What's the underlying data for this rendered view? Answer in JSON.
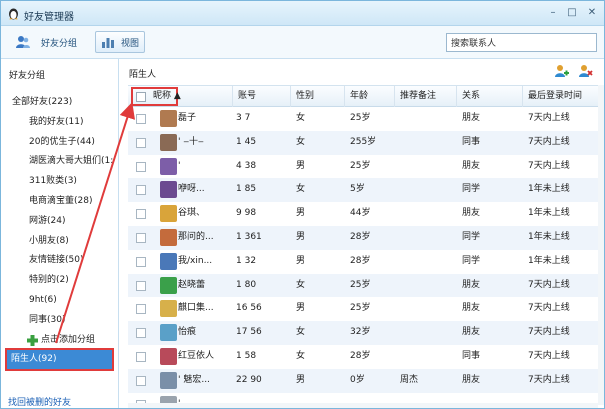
{
  "window": {
    "title": "好友管理器",
    "minimize": "–",
    "maximize": "□",
    "close": "✕"
  },
  "toolbar": {
    "friends_label": "好友分组",
    "view_label": "视图",
    "search_value": "搜索联系人"
  },
  "sidebar": {
    "header": "好友分组",
    "groups": [
      {
        "label": "全部好友(223)",
        "kind": "all"
      },
      {
        "label": "我的好友(11)"
      },
      {
        "label": "20的优生子(44)"
      },
      {
        "label": "湖医滴大哥大姐们(1:"
      },
      {
        "label": "311败类(3)"
      },
      {
        "label": "电商滴宝董(28)"
      },
      {
        "label": "网游(24)"
      },
      {
        "label": "小朋友(8)"
      },
      {
        "label": "友情链接(50)"
      },
      {
        "label": "特别的(2)"
      },
      {
        "label": "9ht(6)"
      },
      {
        "label": "同事(30)"
      },
      {
        "label": "点击添加分组",
        "kind": "add"
      },
      {
        "label": "陌生人(92)",
        "kind": "sel"
      }
    ],
    "find_link": "找回被删的好友"
  },
  "main": {
    "title": "陌生人",
    "columns": [
      "昵称 ▲",
      "账号",
      "性别",
      "年龄",
      "推荐备注",
      "关系",
      "最后登录时间"
    ],
    "rows": [
      {
        "nick": "磊子",
        "acct": "3     7",
        "gender": "女",
        "age": "25岁",
        "note": "",
        "rel": "朋友",
        "last": "7天内上线",
        "color": "#b07a50"
      },
      {
        "nick": "'    ‒十‒",
        "acct": "1     45",
        "gender": "女",
        "age": "255岁",
        "note": "",
        "rel": "同事",
        "last": "7天内上线",
        "color": "#8a6a55"
      },
      {
        "nick": "'",
        "acct": "4     38",
        "gender": "男",
        "age": "25岁",
        "note": "",
        "rel": "朋友",
        "last": "7天内上线",
        "color": "#7d5ea8"
      },
      {
        "nick": "咿呀...",
        "acct": "1     85",
        "gender": "女",
        "age": "5岁",
        "note": "",
        "rel": "同学",
        "last": "1年未上线",
        "color": "#6b4a90"
      },
      {
        "nick": "谷琪、",
        "acct": "9     98",
        "gender": "男",
        "age": "44岁",
        "note": "",
        "rel": "朋友",
        "last": "1年未上线",
        "color": "#d9a43a"
      },
      {
        "nick": "那问的...",
        "acct": "1     361",
        "gender": "男",
        "age": "28岁",
        "note": "",
        "rel": "同学",
        "last": "1年未上线",
        "color": "#c46b3c"
      },
      {
        "nick": "我/xin...",
        "acct": "1     32",
        "gender": "男",
        "age": "28岁",
        "note": "",
        "rel": "同学",
        "last": "1年未上线",
        "color": "#4a78b8"
      },
      {
        "nick": "赵晓蕾",
        "acct": "1     80",
        "gender": "女",
        "age": "25岁",
        "note": "",
        "rel": "朋友",
        "last": "7天内上线",
        "color": "#3aa04a"
      },
      {
        "nick": "麒口集...",
        "acct": "16     56",
        "gender": "男",
        "age": "25岁",
        "note": "",
        "rel": "朋友",
        "last": "7天内上线",
        "color": "#d7b04a"
      },
      {
        "nick": "怡痕",
        "acct": "17     56",
        "gender": "女",
        "age": "32岁",
        "note": "",
        "rel": "朋友",
        "last": "7天内上线",
        "color": "#5aa0c8"
      },
      {
        "nick": "红豆依人",
        "acct": "1     58",
        "gender": "女",
        "age": "28岁",
        "note": "",
        "rel": "同事",
        "last": "7天内上线",
        "color": "#b84a5a"
      },
      {
        "nick": "' 魅宏...",
        "acct": "22     90",
        "gender": "男",
        "age": "0岁",
        "note": "周杰",
        "rel": "朋友",
        "last": "7天内上线",
        "color": "#7a8fa8"
      },
      {
        "nick": "'  ...",
        "acct": "",
        "gender": "",
        "age": "",
        "note": "",
        "rel": "",
        "last": "",
        "color": "#9aa3ad"
      }
    ]
  }
}
